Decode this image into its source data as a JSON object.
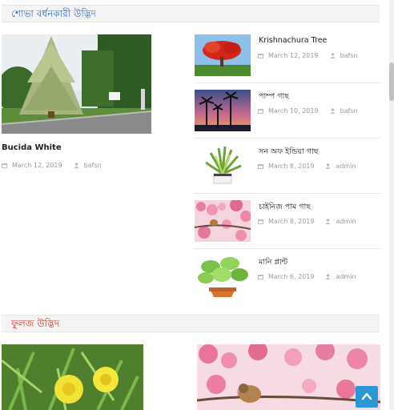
{
  "sections": [
    {
      "title": "শোভা বর্ধনকারী উদ্ভিদ"
    },
    {
      "title": "ফুলজ উদ্ভিদ"
    }
  ],
  "featured": {
    "title": "Bucida White",
    "date": "March 12, 2019",
    "author": "bafsn"
  },
  "posts": [
    {
      "title": "Krishnachura Tree",
      "date": "March 12, 2019",
      "author": "bafsn"
    },
    {
      "title": "পাম্প গাছ",
      "date": "March 10, 2019",
      "author": "bafsn"
    },
    {
      "title": "সন অফ ইন্ডিয়া গাছ",
      "date": "March 8, 2019",
      "author": "admin"
    },
    {
      "title": "চাইনিজ পাম গাছ",
      "date": "March 8, 2019",
      "author": "admin"
    },
    {
      "title": "মানি প্লান্ট",
      "date": "March 6, 2019",
      "author": "admin"
    }
  ],
  "colors": {
    "section1_title": "#2e6fc0",
    "section2_title": "#d0362a",
    "meta_text": "#9a9a9a",
    "scroll_top_button": "#2b97d4"
  },
  "icons": {
    "date": "calendar-icon",
    "author": "user-icon",
    "scroll_top": "chevron-up-icon"
  }
}
